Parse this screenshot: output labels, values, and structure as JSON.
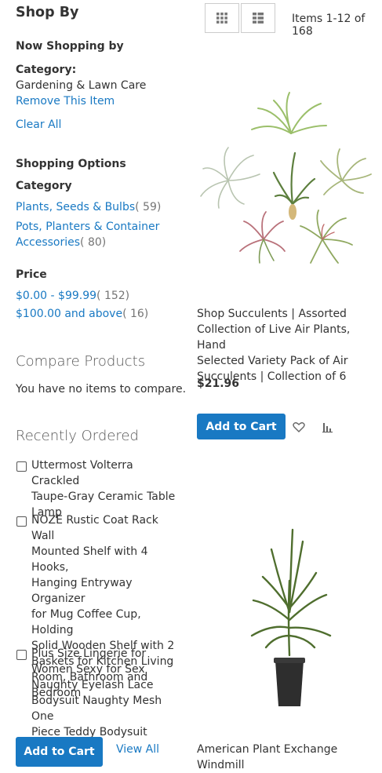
{
  "sidebar": {
    "title": "Shop By",
    "now_shopping": {
      "heading": "Now Shopping by",
      "filter_label": "Category:",
      "filter_value": "Gardening & Lawn Care",
      "remove_label": "Remove This Item",
      "clear_all": "Clear All"
    },
    "shopping_options": {
      "heading": "Shopping Options",
      "category": {
        "title": "Category",
        "items": [
          {
            "label": "Plants, Seeds & Bulbs",
            "count": "( 59)"
          },
          {
            "label_line1": "Pots, Planters & Container",
            "label_line2": "Accessories",
            "count": "( 80)"
          }
        ]
      },
      "price": {
        "title": "Price",
        "items": [
          {
            "label": "$0.00 - $99.99",
            "count": "( 152)"
          },
          {
            "label": "$100.00 and above",
            "count": "( 16)"
          }
        ]
      }
    },
    "compare": {
      "heading": "Compare Products",
      "empty": "You have no items to compare."
    },
    "recently_ordered": {
      "heading": "Recently Ordered",
      "items": [
        {
          "lines": [
            "Uttermost Volterra Crackled",
            "Taupe-Gray Ceramic Table",
            "Lamp"
          ]
        },
        {
          "lines": [
            "NOZE Rustic Coat Rack Wall",
            "Mounted Shelf with 4 Hooks,",
            "Hanging Entryway Organizer",
            "for Mug Coffee Cup, Holding",
            "Solid Wooden Shelf with 2",
            "Baskets for Kitchen Living",
            "Room, Bathroom and",
            "Bedroom"
          ]
        },
        {
          "lines": [
            "Plus Size Lingerie for",
            "Women Sexy for Sex",
            "Naughty Eyelash Lace",
            "Bodysuit Naughty Mesh One",
            "Piece Teddy Bodysuit Outfits"
          ]
        }
      ],
      "add_to_cart": "Add to Cart",
      "view_all": "View All"
    }
  },
  "toolbar": {
    "items_count": "Items 1-12 of 168",
    "modes": [
      "grid-icon",
      "list-icon"
    ]
  },
  "products": [
    {
      "name_lines": [
        "Shop Succulents | Assorted",
        "Collection of Live Air Plants, Hand",
        "Selected Variety Pack of Air",
        "Succulents | Collection of 6"
      ],
      "price": "$21.96",
      "add_to_cart": "Add to Cart",
      "image": "air-plants-image"
    },
    {
      "name_lines": [
        "American Plant Exchange Windmill"
      ],
      "image": "windmill-palm-image"
    }
  ],
  "colors": {
    "link": "#1979c3",
    "primary": "#1979c3",
    "text": "#333333"
  }
}
